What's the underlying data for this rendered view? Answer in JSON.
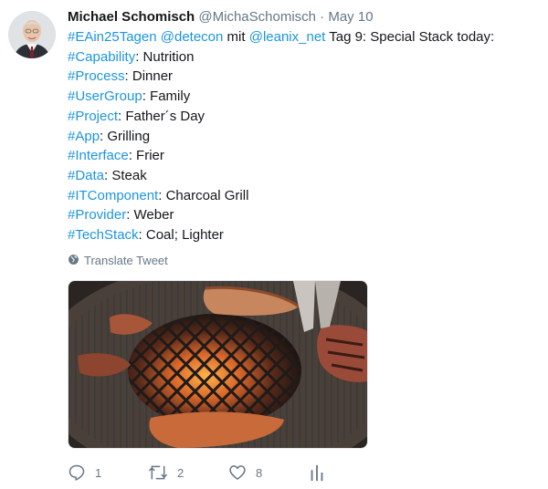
{
  "tweet": {
    "author_name": "Michael Schomisch",
    "handle": "@MichaSchomisch",
    "separator": "·",
    "date": "May 10",
    "first_line": {
      "tag1": "#EAin25Tagen",
      "mention1": "@detecon",
      "mit": " mit ",
      "mention2": "@leanix_net",
      "rest": " Tag 9: Special Stack today:"
    },
    "lines": [
      {
        "tag": "#Capability",
        "text": ": Nutrition"
      },
      {
        "tag": "#Process",
        "text": ": Dinner"
      },
      {
        "tag": "#UserGroup",
        "text": ": Family"
      },
      {
        "tag": "#Project",
        "text": ": Father´s Day"
      },
      {
        "tag": "#App",
        "text": ": Grilling"
      },
      {
        "tag": "#Interface",
        "text": ": Frier"
      },
      {
        "tag": "#Data",
        "text": ": Steak"
      },
      {
        "tag": "#ITComponent",
        "text": ": Charcoal Grill"
      },
      {
        "tag": "#Provider",
        "text": ": Weber"
      },
      {
        "tag": "#TechStack",
        "text": ": Coal; Lighter"
      }
    ],
    "translate_label": "Translate Tweet",
    "actions": {
      "replies": "1",
      "retweets": "2",
      "likes": "8"
    }
  },
  "icons": {
    "globe": "globe-icon",
    "reply": "reply-icon",
    "retweet": "retweet-icon",
    "like": "heart-icon",
    "analytics": "analytics-icon"
  },
  "colors": {
    "link": "#1b95e0",
    "text": "#14171a",
    "muted": "#657786"
  }
}
